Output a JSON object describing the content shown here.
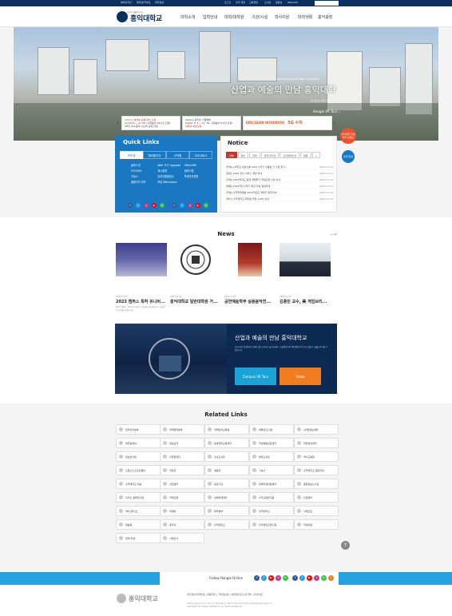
{
  "topbar": {
    "links": [
      "예비홍익인",
      "재학생/학부모",
      "대학원생",
      "로그인",
      "홍익 계정",
      "교육행정",
      "도서관",
      "열람실",
      "ENGLISH"
    ]
  },
  "header": {
    "logo_sub": "산업과 예술의 만남",
    "logo_text": "홍익대학교",
    "nav": [
      "대학소개",
      "입학안내",
      "대학/대학원",
      "기관/시설",
      "학사지원",
      "대학생활",
      "홍익광장"
    ]
  },
  "hero": {
    "kicker": "Welcome to Hongik University",
    "title": "산업과 예술의 만남 홍익대학",
    "sub": "내 손으로 만든 대학",
    "vr": "Hongik VR Tour ›"
  },
  "banners": [
    {
      "line1": "2023-2 예약분 등록 면허 교육",
      "line2": "(23.9.20 ~ 11.30 / 사회봉사 24시간 인정)",
      "line3": "2학기 이수증이 나오며 교육 인정"
    },
    {
      "line1": "2023-2 온라인 기업체와",
      "line2": "(2023. 9. 4 ~ 11. 30. 사회봉사 8시간 인정)",
      "line3": "성폭력 예방교육"
    },
    {
      "line1": "ERICSSON WOOXOOO",
      "line2": "5G 수칙",
      "line3": ""
    }
  ],
  "quick_links": {
    "title": "Quick Links",
    "tabs": [
      "학부생",
      "예비홍익인",
      "교직원",
      "주요서비스"
    ],
    "rows": [
      [
        "클래스넷",
        "Web TUT Upgrade",
        "Office365"
      ],
      [
        "ITS서비스",
        "재시험원",
        "캠퍼스맵"
      ],
      [
        "가상시",
        "온라인통합접수",
        "학생안전생활"
      ],
      [
        "홈페이지 공모",
        "포상 Workspace",
        ""
      ]
    ]
  },
  "notice": {
    "title": "Notice",
    "tabs": [
      "전체",
      "일반",
      "학생",
      "장학/학자금",
      "오리엔테이션",
      "채용",
      "+"
    ],
    "items": [
      {
        "title": "[학생] 1대학교 일반소통 2023 1학기 소통분 간 수업 참가...",
        "date": "2023.11.24"
      },
      {
        "title": "[일반] 2024 전산 서비스 개편 안내",
        "date": "2023.11.24"
      },
      {
        "title": "[학생] 2023학년도 동계 계절학기 학점교류 신청 안내",
        "date": "2023.11.24"
      },
      {
        "title": "[채용] 2024학년 2학기 특강 개설 일정안내",
        "date": "2023.11.24"
      },
      {
        "title": "[학생] 홍익학습생활 2023학년도 계열기 업무안내",
        "date": "2023.11.24"
      },
      {
        "title": "[행사] 홍익대학교 대학원 학위 수여식 안내",
        "date": "2023.11.24"
      }
    ]
  },
  "side": {
    "survey": "우리대학 학생들의 만족도",
    "feedback": "홍익 만족",
    "accessibility": "홍익발전"
  },
  "news": {
    "title": "News",
    "more": "+",
    "items": [
      {
        "date": "2023.11.27",
        "title": "2023 캠퍼스 특허 유니버...",
        "desc": "2023 캠퍼스 특허 유니버시티 발표에서 홍익대학교 공과대학 성과를 보였습니다"
      },
      {
        "date": "2023.11.24",
        "title": "홍익대학교 일반대학원 가...",
        "desc": ""
      },
      {
        "date": "2023.11.24",
        "title": "공연예술학부 실용음악전...",
        "desc": ""
      },
      {
        "date": "2023.11.23",
        "title": "김종민 교수, 美 게임브리...",
        "desc": ""
      }
    ]
  },
  "vr_tour": {
    "title": "산업과 예술의 만남 홍익대학교",
    "desc": "지금 바로 홍익대학교 캠퍼스를 가상으로 둘러보세요. 서울캠퍼스와 세종캠퍼스의 주요 건물과 시설을 만나볼 수 있습니다.",
    "campus_btn": "Campus VR Tour",
    "video_btn": "Video"
  },
  "related_links": {
    "title": "Related Links",
    "items": [
      "입학관리본부",
      "국제협력본부",
      "국제언어교육원",
      "박물관/도서관",
      "e학업정보센터",
      "대학원/특수",
      "정보공개",
      "공과대학교육센터",
      "학생생활상담센터",
      "학업성취센터",
      "정보전산원",
      "산학협력단",
      "홍보도서관",
      "법무도서관",
      "역사교육원",
      "오픈소스소프트웨어",
      "직장관",
      "생활관",
      "기숙사",
      "홍익대학교 열린학습",
      "홍익대학교 이념",
      "인권센터",
      "공공기관",
      "장애학생지원센터",
      "종합정보도서관",
      "디자인 경영연구원",
      "국제교류",
      "장애학생센터",
      "홍익교육연구원",
      "인권센터",
      "FM스튜디오",
      "학생회",
      "대학본부",
      "홍익대학교",
      "구매조달",
      "재활용",
      "총무과",
      "홍익대학교",
      "홍익대학교연구원",
      "학생지원",
      "현재 학생",
      "사업인식"
    ]
  },
  "follow": {
    "label": "Follow Hongik Online"
  },
  "footer": {
    "logo_text": "홍익대학교",
    "links": "개인정보처리방침  |  이용약관  |  저작권보호  |  이메일무단수집거부  |  사이트맵",
    "addr1": "04066 서울특별시 마포구 와우산로 94 홍익대학교  TEL 02-320-1114  Email webmaster@hongik.ac.kr",
    "addr2": "COPYRIGHT BY HONGIK UNIVERSITY. ALL RIGHTS RESERVED."
  },
  "colors": {
    "navy": "#0b2f5e",
    "quick_blue": "#1a78c2",
    "notice_red": "#c0392b",
    "follow_blue": "#24a3e0",
    "vr_cyan": "#1aa3d6",
    "vr_orange": "#f07d1f"
  }
}
